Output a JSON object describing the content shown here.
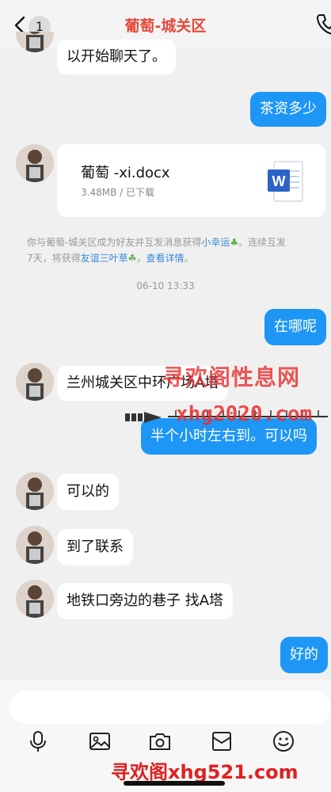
{
  "header": {
    "back_badge": "1",
    "title": "葡萄-城关区"
  },
  "messages": {
    "m1": "以开始聊天了。",
    "m2": "茶资多少",
    "m4": "在哪呢",
    "m5": "兰州城关区中环广场A塔",
    "m6": "半个小时左右到。可以吗",
    "m7": "可以的",
    "m8": "到了联系",
    "m9": "地铁口旁边的巷子 找A塔",
    "m10": "好的"
  },
  "file": {
    "name": "葡萄 -xi.docx",
    "meta": "3.48MB / 已下载",
    "icon": "word-doc-icon"
  },
  "system_note": {
    "line1_a": "你与葡萄-城关区成为好友并互发消息获得",
    "line1_link": "小幸运",
    "line1_b": "。连续互发",
    "line2_a": "7天，将获得",
    "line2_link": "友谊三叶草",
    "line2_b": "，",
    "line2_link2": "查看详情",
    "line2_c": "。"
  },
  "timestamp": "06-10 13:33",
  "watermarks": {
    "overlay_text": "寻欢阁性息网",
    "overlay_url": "xhg2020.com",
    "bottom": "寻欢阁xhg521.com"
  },
  "toolbar": [
    "mic-icon",
    "image-icon",
    "camera-icon",
    "red-packet-icon",
    "emoji-icon"
  ],
  "colors": {
    "accent": "#1e96f5",
    "title": "#e8483a",
    "link": "#3a8ad6",
    "watermark": "#e82e2e"
  }
}
